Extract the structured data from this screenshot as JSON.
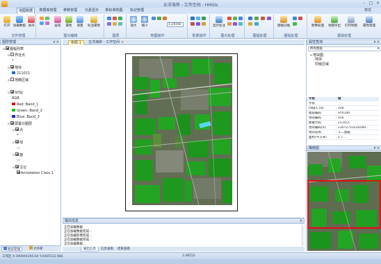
{
  "app": {
    "title": "五洋海岸 - 工作空间 - HHGis"
  },
  "ribbon": {
    "tabs": [
      "地图数据",
      "数据库管理",
      "参数管理",
      "元素显示",
      "新标准地图",
      "标记管理"
    ],
    "style_label": "样式",
    "groups": [
      {
        "label": "文件管理",
        "buttons": [
          "打开",
          "加载数据",
          "关闭"
        ]
      },
      {
        "label": "图元编辑",
        "buttons": [
          "画笔",
          "属性",
          "测量",
          "标注属性"
        ]
      },
      {
        "label": "图层",
        "buttons": []
      },
      {
        "label": "地图操作",
        "buttons": [
          "放大",
          "缩小"
        ],
        "scale_value": "1:24192"
      },
      {
        "label": "影像操作",
        "buttons": []
      },
      {
        "label": "图元处理",
        "buttons": [
          "显示标注"
        ]
      },
      {
        "label": "图幅处理",
        "buttons": []
      },
      {
        "label": "图幅处理",
        "buttons": [
          "图幅分幅"
        ]
      },
      {
        "label": "基础处理",
        "buttons": [
          "图像处理",
          "地图导出",
          "打印地图",
          "属性管理"
        ]
      }
    ]
  },
  "layer_panel": {
    "title": "图层管理",
    "tree": [
      {
        "label": "图幅列表",
        "level": 0,
        "checked": true,
        "expand": "-"
      },
      {
        "label": "界址点",
        "level": 1,
        "checked": false,
        "expand": "-"
      },
      {
        "label": "*",
        "level": 2,
        "checked": null
      },
      {
        "label": "地块",
        "level": 1,
        "checked": true,
        "expand": "-"
      },
      {
        "label": "211011",
        "level": 2,
        "checked": null,
        "swatch": "#1a6fc9"
      },
      {
        "label": "地籍区域",
        "level": 1,
        "checked": false,
        "expand": "-"
      },
      {
        "label": "",
        "level": 2,
        "checked": null
      },
      {
        "label": "SOSJ",
        "level": 1,
        "checked": true,
        "expand": "-"
      },
      {
        "label": "RGB",
        "level": 2,
        "checked": null
      },
      {
        "label": "Red:   Band_1",
        "level": 2,
        "checked": null,
        "swatch": "#e01818"
      },
      {
        "label": "Green: Band_2",
        "level": 2,
        "checked": null,
        "swatch": "#18c018"
      },
      {
        "label": "Blue:   Band_3",
        "level": 2,
        "checked": null,
        "swatch": "#1828d0"
      },
      {
        "label": "屏幕分图层",
        "level": 1,
        "checked": true,
        "expand": "-"
      },
      {
        "label": "点",
        "level": 2,
        "checked": true,
        "expand": "-"
      },
      {
        "label": "*",
        "level": 3,
        "checked": null
      },
      {
        "label": "线",
        "level": 2,
        "checked": true,
        "expand": "-"
      },
      {
        "label": "—",
        "level": 3,
        "checked": null
      },
      {
        "label": "面",
        "level": 2,
        "checked": true,
        "expand": "-"
      },
      {
        "label": "",
        "level": 3,
        "checked": null,
        "swatch": "#dfe6ef"
      },
      {
        "label": "注记",
        "level": 2,
        "checked": true,
        "expand": "-"
      },
      {
        "label": "Annotation Class 1",
        "level": 3,
        "checked": true
      }
    ],
    "bottom_tabs": [
      "图层管理",
      "文件库"
    ]
  },
  "document": {
    "tabs": [
      {
        "label": "布局 1",
        "active": true
      },
      {
        "label": "五洋海岸 - 工作空间",
        "active": false
      }
    ]
  },
  "output": {
    "title": "输出信息",
    "lines": [
      "正在加载数据",
      "正在加载数据完成...",
      "正在加载影像完成...",
      "正在加载数据完成...",
      "正在加载数据..."
    ],
    "tabs": [
      "输出信息",
      "信息查看",
      "结果查看"
    ]
  },
  "attr_panel": {
    "title": "属性查询",
    "select_label": "所有图层",
    "tree": [
      "地块图",
      "地块",
      "村级区域"
    ]
  },
  "props_panel": {
    "headers": [
      "字段",
      "值"
    ],
    "rows": [
      {
        "k": "字段",
        "v": ""
      },
      {
        "k": "OBJECTID",
        "v": "256"
      },
      {
        "k": "图层编码",
        "v": "SYX140"
      },
      {
        "k": "地块编码",
        "v": "256"
      },
      {
        "k": "要素代码",
        "v": "211011"
      },
      {
        "k": "地块编码(X)",
        "v": "13072710120589..."
      },
      {
        "k": "地块名称",
        "v": "十二图斑"
      },
      {
        "k": "面积(平方米)",
        "v": "1.7..."
      }
    ]
  },
  "overview_panel": {
    "title": "鹰眼图"
  },
  "status": {
    "coords": "X:390944395.64  Y:4405512.984",
    "scale": "1:48152",
    "left_label": "工作区"
  }
}
